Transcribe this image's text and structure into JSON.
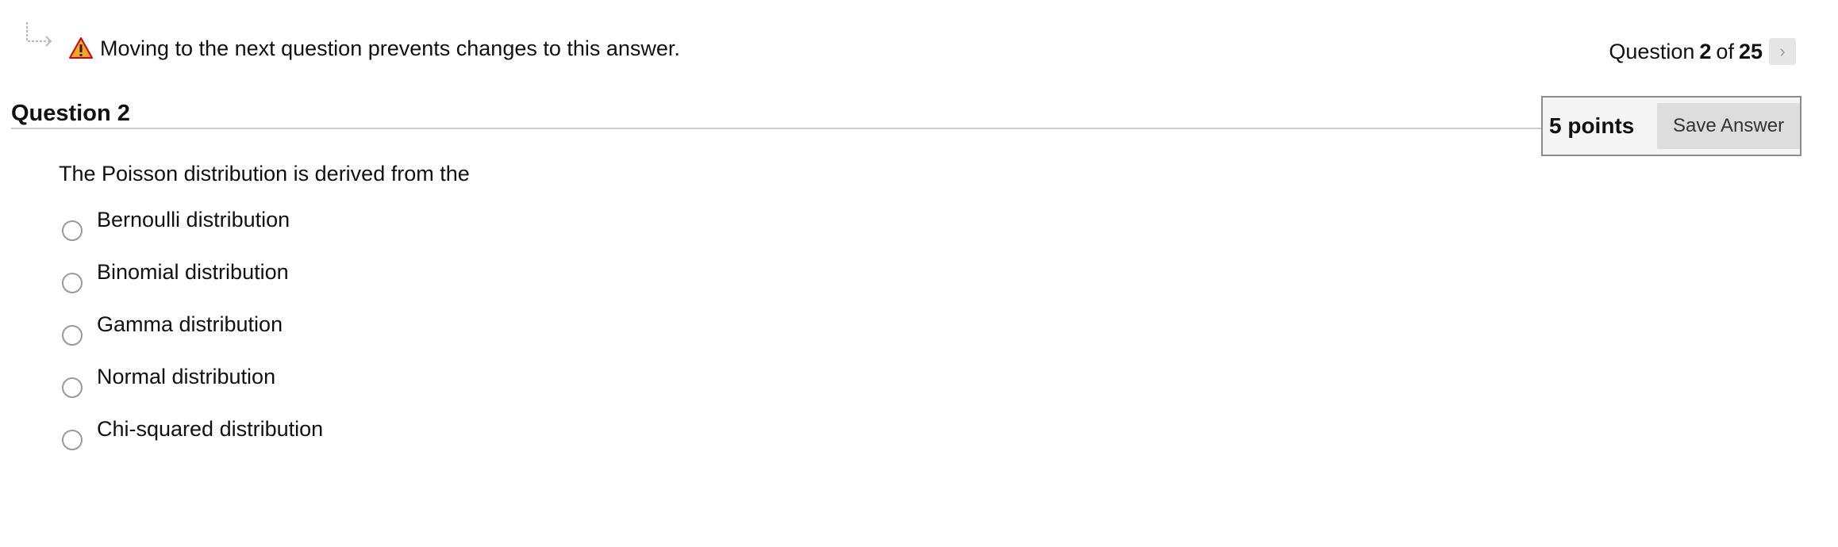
{
  "notice": {
    "icon": "warning-icon",
    "text": "Moving to the next question prevents changes to this answer."
  },
  "pagination": {
    "prefix": "Question",
    "current": "2",
    "of": "of",
    "total": "25",
    "next_icon": "chevron-right-icon"
  },
  "question": {
    "title": "Question 2",
    "points": "5 points",
    "save_label": "Save Answer",
    "prompt": "The Poisson distribution is derived from the",
    "options": [
      {
        "label": "Bernoulli distribution",
        "selected": false
      },
      {
        "label": "Binomial distribution",
        "selected": false
      },
      {
        "label": "Gamma distribution",
        "selected": false
      },
      {
        "label": "Normal distribution",
        "selected": false
      },
      {
        "label": "Chi-squared distribution",
        "selected": false
      }
    ]
  },
  "colors": {
    "warning_fill": "#f5a623",
    "warning_outline": "#d0021b",
    "rule": "#cccccc",
    "button_bg": "#dddddd"
  }
}
